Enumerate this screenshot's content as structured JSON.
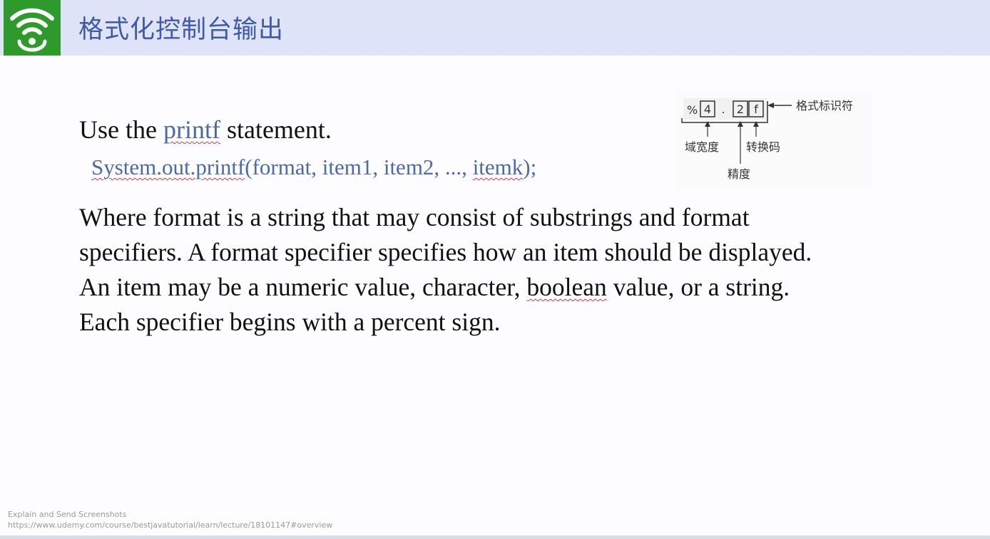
{
  "slide": {
    "title": "格式化控制台输出",
    "intro_prefix": "Use the ",
    "intro_keyword": "printf",
    "intro_suffix": " statement.",
    "code_prefix": "System.out.printf",
    "code_middle": "(format, item1, item2, ..., ",
    "code_last": "itemk",
    "code_suffix": ");",
    "paragraph_line1": "Where format is a string that may consist of substrings and format",
    "paragraph_line2": "specifiers. A format specifier specifies how an item should be displayed.",
    "paragraph_line3_a": "An item may be a numeric value, character, ",
    "paragraph_line3_b": "boolean",
    "paragraph_line3_c": " value, or a string.",
    "paragraph_line4": "Each specifier begins with a percent sign."
  },
  "diagram": {
    "percent": "%",
    "width_digit": "4",
    "dot": ".",
    "precision_digit": "2",
    "conversion_char": "f",
    "label_format_specifier": "格式标识符",
    "label_field_width": "域宽度",
    "label_conversion": "转换码",
    "label_precision": "精度"
  },
  "footer": {
    "caption": "Explain and Send Screenshots",
    "url": "https://www.udemy.com/course/bestjavatutorial/learn/lecture/18101147#overview"
  },
  "colors": {
    "header_bg": "#dfe3f7",
    "title": "#3f5aa6",
    "logo_bg": "#2f9a2c",
    "keyword": "#4b6aa8",
    "spellcheck": "#d43c3c"
  },
  "icons": {
    "logo": "wifi-icon"
  }
}
